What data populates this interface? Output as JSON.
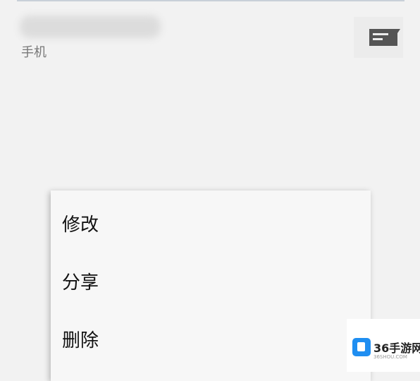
{
  "contact": {
    "name": "███████████",
    "subtitle": "手机"
  },
  "context_menu": {
    "items": [
      {
        "label": "修改"
      },
      {
        "label": "分享"
      },
      {
        "label": "删除"
      }
    ]
  },
  "watermark": {
    "text": "36手游网",
    "url": "36SHOU.COM"
  },
  "icons": {
    "message": "message-icon",
    "logo": "cube-logo-icon"
  },
  "colors": {
    "background": "#f2f2f2",
    "menu_background": "#f7f7f7",
    "icon_dark": "#555555",
    "brand_blue": "#1f8ef1"
  }
}
